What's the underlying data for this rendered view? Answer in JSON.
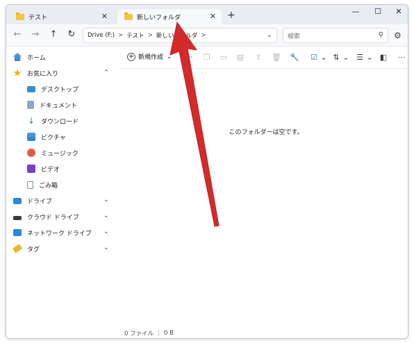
{
  "tabs": [
    {
      "label": "テスト",
      "close": "✕",
      "active": false
    },
    {
      "label": "新しいフォルダ",
      "close": "✕",
      "active": true
    }
  ],
  "new_tab_label": "+",
  "window_controls": {
    "minimize": "—",
    "maximize": "☐",
    "close": "✕"
  },
  "nav": {
    "back": "←",
    "forward": "→",
    "up": "↑",
    "refresh": "↻"
  },
  "address": {
    "drive": "Drive (F:)",
    "folder1": "テスト",
    "folder2": "新しいフォルダ",
    "separator": ">"
  },
  "search": {
    "placeholder": "検索",
    "icon": "search-icon"
  },
  "sidebar": {
    "home": "ホーム",
    "favorites": "お気に入り",
    "favorite_items": [
      "デスクトップ",
      "ドキュメント",
      "ダウンロード",
      "ピクチャ",
      "ミュージック",
      "ビデオ",
      "ごみ箱"
    ],
    "drive": "ドライブ",
    "cloud": "クラウド ドライブ",
    "network": "ネットワーク ドライブ",
    "tags": "タグ"
  },
  "command_bar": {
    "new_label": "新規作成"
  },
  "content": {
    "empty_message": "このフォルダーは空です。"
  },
  "status": {
    "item_count": "0 ファイル",
    "size": "0 B"
  },
  "colors": {
    "accent": "#0067c0",
    "folder": "#f4c543",
    "arrow": "#d42a2a"
  }
}
